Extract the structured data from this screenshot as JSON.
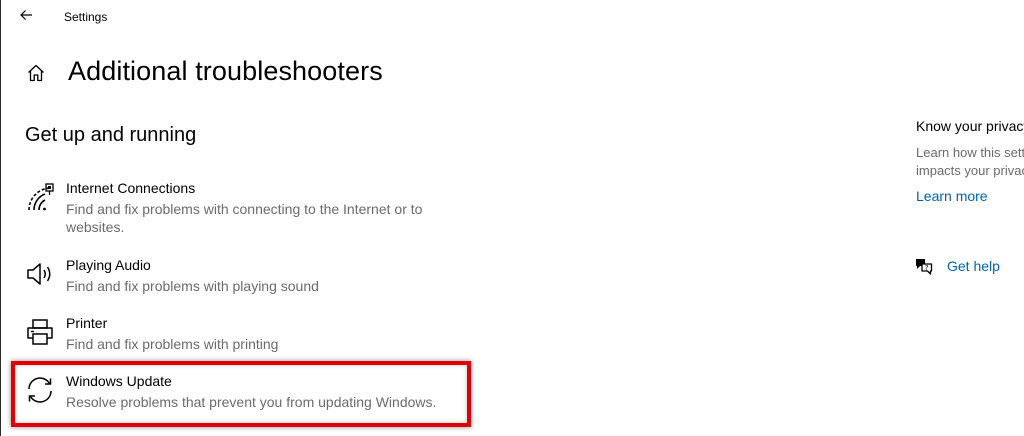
{
  "window": {
    "app_title": "Settings",
    "back_icon": "back-arrow-icon"
  },
  "header": {
    "home_icon": "home-icon",
    "page_title": "Additional troubleshooters"
  },
  "section": {
    "title": "Get up and running",
    "items": [
      {
        "icon": "wifi-signal-icon",
        "name": "Internet Connections",
        "description": "Find and fix problems with connecting to the Internet or to websites."
      },
      {
        "icon": "speaker-icon",
        "name": "Playing Audio",
        "description": "Find and fix problems with playing sound"
      },
      {
        "icon": "printer-icon",
        "name": "Printer",
        "description": "Find and fix problems with printing"
      },
      {
        "icon": "sync-icon",
        "name": "Windows Update",
        "description": "Resolve problems that prevent you from updating Windows."
      }
    ]
  },
  "side_panel": {
    "heading": "Know your privacy",
    "text": "Learn how this setting impacts your privacy.",
    "link": "Learn more",
    "help_icon": "chat-help-icon",
    "help_label": "Get help"
  },
  "annotation": {
    "highlight_color": "#e00000"
  },
  "colors": {
    "link": "#0063b1",
    "secondary_text": "#6b6b6b"
  }
}
